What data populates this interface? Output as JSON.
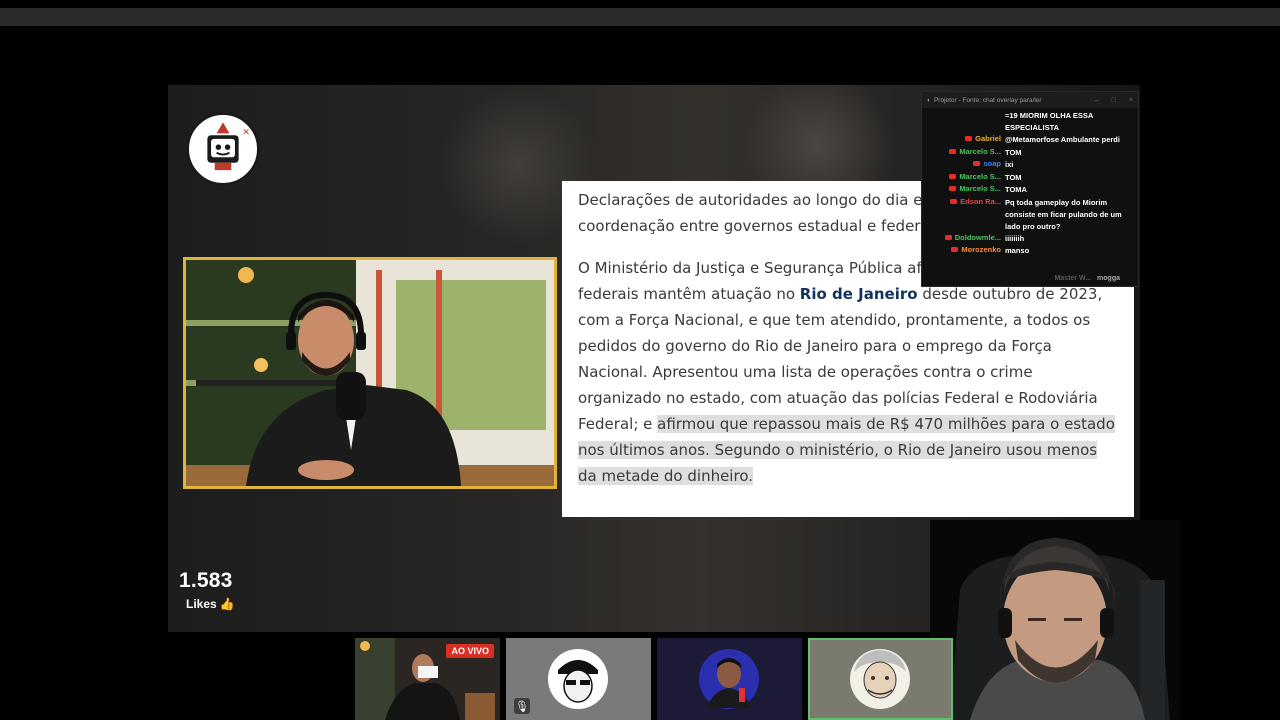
{
  "article": {
    "para1": "Declarações de autoridades ao longo do dia e revelaram a falta de coordenação entre governos estadual e federal.",
    "para2_a": "O Ministério da Justiça e Segurança Pública afirmou que as forças federais mantêm atuação no ",
    "para2_link": "Rio de Janeiro",
    "para2_b": " desde outubro de 2023, com a Força Nacional, e que tem atendido, prontamente, a todos os pedidos do governo do Rio de Janeiro para o emprego da Força Nacional. Apresentou uma lista de operações contra o crime organizado no estado, com atuação das polícias Federal e Rodoviária Federal; e ",
    "para2_hl": "afirmou que repassou mais de R$ 470 milhões para o estado nos últimos anos. Segundo o ministério, o Rio de Janeiro usou menos da metade do dinheiro."
  },
  "likes": {
    "count": "1.583",
    "label": "Likes",
    "icon": "thumbs-up-icon"
  },
  "chat": {
    "title": "Projetor - Fonte: chat overlay para/ler",
    "controls": [
      "–",
      "□",
      "×"
    ],
    "messages": [
      {
        "name": "",
        "color": "#ffffff",
        "text": "=19 MIORIM OLHA ESSA ESPECIALISTA"
      },
      {
        "name": "Gabriel",
        "color": "#e0b43a",
        "text": "@Metamorfose Ambulante perdi"
      },
      {
        "name": "Marcelo S...",
        "color": "#4ec25f",
        "text": "TOM"
      },
      {
        "name": "soap",
        "color": "#3b82f6",
        "text": "ixi"
      },
      {
        "name": "Marcelo S...",
        "color": "#4ec25f",
        "text": "TOM"
      },
      {
        "name": "Marcelo S...",
        "color": "#4ec25f",
        "text": "TOMA"
      },
      {
        "name": "Edson Ra...",
        "color": "#e5484d",
        "text": "Pq toda gameplay do Miorim consiste em ficar pulando de um lado pro outro?"
      },
      {
        "name": "Doldowmle...",
        "color": "#4ec25f",
        "text": "iiiiiiih"
      },
      {
        "name": "Morozenko",
        "color": "#ff8a3d",
        "text": "manso"
      }
    ],
    "footer_name": "Master W...",
    "footer_text": "mogga"
  },
  "tiles": {
    "live_label": "AO VIVO"
  },
  "colors": {
    "accent_gold": "#e0b43a",
    "live_red": "#d93025",
    "highlight_green": "#5fbf6a",
    "link_blue": "#13325b"
  }
}
